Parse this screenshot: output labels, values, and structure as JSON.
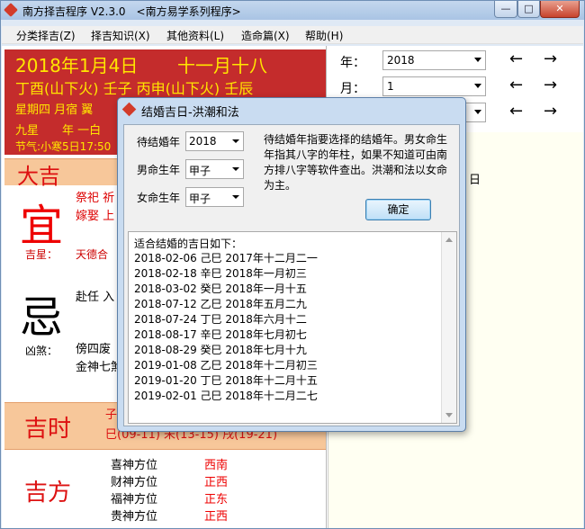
{
  "window": {
    "title": "南方择吉程序 V2.3.0　<南方易学系列程序>",
    "controls": {
      "minimize": "—",
      "maximize": "□",
      "close": "✕"
    }
  },
  "menu": [
    "分类择吉(Z)",
    "择吉知识(X)",
    "其他资料(L)",
    "造命篇(X)",
    "帮助(H)"
  ],
  "date_panel": {
    "date": "2018年1月4日",
    "lunar": "十一月十八",
    "line2": "丁酉(山下火)  壬子  丙申(山下火)  壬辰",
    "line3": "星期四  月宿  翼",
    "line4": "九星　　年 一白",
    "line5": "节气:小寒5日17:50"
  },
  "controls": {
    "year_label": "年：",
    "year_value": "2018",
    "month_label": "月：",
    "month_value": "1",
    "prev": "←",
    "next": "→"
  },
  "daily": {
    "header": "大吉",
    "yi": "宜",
    "yi_items": [
      "祭祀 祈",
      "嫁娶 上"
    ],
    "jixing_label": "吉星：",
    "jixing_value": "天德合",
    "ji": "忌",
    "ji_items": "赴任 入",
    "xiong_label": "凶煞：",
    "xiong_values": [
      "傍四废",
      "金神七煞"
    ]
  },
  "jishi": {
    "label": "吉时",
    "line1": "子",
    "line2": "巳(09-11) 未(13-15) 戌(19-21)"
  },
  "fangwei": {
    "label": "吉方",
    "rows": [
      {
        "name": "喜神方位",
        "value": "西南"
      },
      {
        "name": "财神方位",
        "value": "正西"
      },
      {
        "name": "福神方位",
        "value": "正东"
      },
      {
        "name": "贵神方位",
        "value": "正西"
      }
    ]
  },
  "right_panel": {
    "text": "日"
  },
  "dialog": {
    "title": "结婚吉日-洪潮和法",
    "year_label": "待结婚年",
    "year_value": "2018",
    "male_label": "男命生年",
    "male_value": "甲子",
    "female_label": "女命生年",
    "female_value": "甲子",
    "description": "待结婚年指要选择的结婚年。男女命生年指其八字的年柱，如果不知道可由南方排八字等软件查出。洪潮和法以女命为主。",
    "ok_label": "确定",
    "result_header": "适合结婚的吉日如下：",
    "results": [
      "2018-02-06 己巳 2017年十二月二一",
      "2018-02-18 辛巳 2018年一月初三",
      "2018-03-02 癸巳 2018年一月十五",
      "2018-07-12 乙巳 2018年五月二九",
      "2018-07-24 丁巳 2018年六月十二",
      "2018-08-17 辛巳 2018年七月初七",
      "2018-08-29 癸巳 2018年七月十九",
      "2019-01-08 乙巳 2018年十二月初三",
      "2019-01-20 丁巳 2018年十二月十五",
      "2019-02-01 己巳 2018年十二月二七"
    ]
  }
}
